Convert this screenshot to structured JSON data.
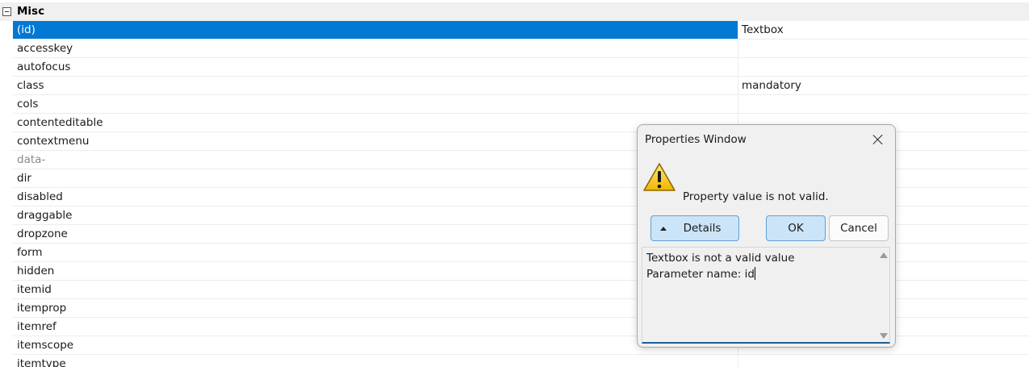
{
  "category": {
    "label": "Misc"
  },
  "properties": [
    {
      "name": "(id)",
      "value": "Textbox",
      "selected": true
    },
    {
      "name": "accesskey",
      "value": ""
    },
    {
      "name": "autofocus",
      "value": ""
    },
    {
      "name": "class",
      "value": "mandatory"
    },
    {
      "name": "cols",
      "value": ""
    },
    {
      "name": "contenteditable",
      "value": ""
    },
    {
      "name": "contextmenu",
      "value": ""
    },
    {
      "name": "data-",
      "value": "",
      "dim": true
    },
    {
      "name": "dir",
      "value": ""
    },
    {
      "name": "disabled",
      "value": ""
    },
    {
      "name": "draggable",
      "value": ""
    },
    {
      "name": "dropzone",
      "value": ""
    },
    {
      "name": "form",
      "value": ""
    },
    {
      "name": "hidden",
      "value": ""
    },
    {
      "name": "itemid",
      "value": ""
    },
    {
      "name": "itemprop",
      "value": ""
    },
    {
      "name": "itemref",
      "value": ""
    },
    {
      "name": "itemscope",
      "value": ""
    },
    {
      "name": "itemtype",
      "value": ""
    }
  ],
  "dialog": {
    "title": "Properties Window",
    "message": "Property value is not valid.",
    "details_button": "Details",
    "ok_button": "OK",
    "cancel_button": "Cancel",
    "details_line1": "Textbox is not a valid value",
    "details_line2": "Parameter name: id",
    "icon": "warning-icon"
  },
  "colors": {
    "selection": "#0078d4",
    "button_accent": "#cce4f7"
  }
}
